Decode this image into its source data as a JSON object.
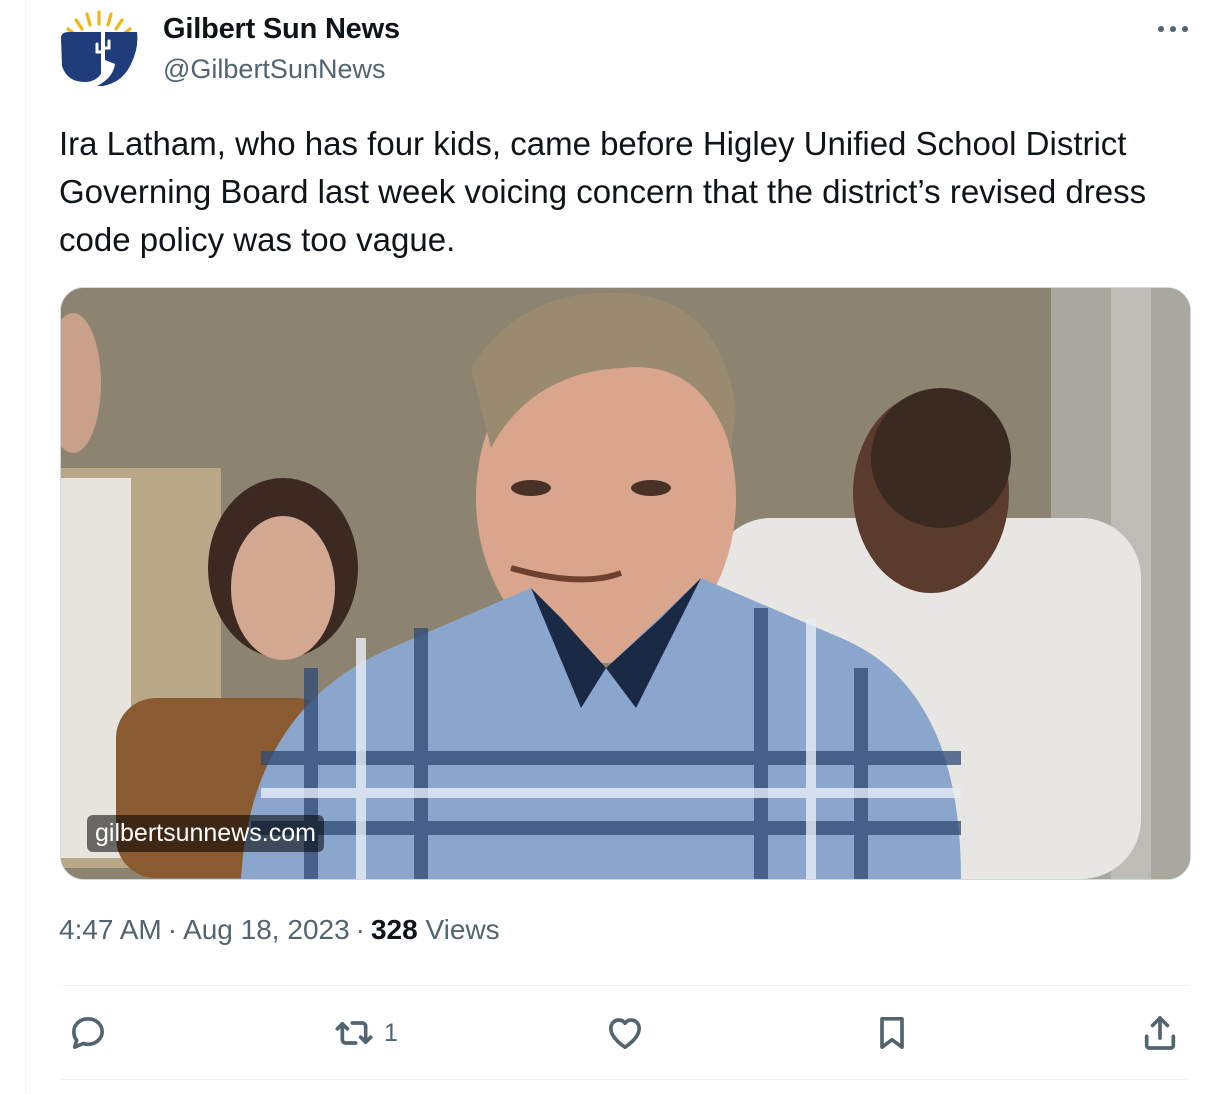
{
  "author": {
    "name": "Gilbert Sun News",
    "handle": "@GilbertSunNews",
    "avatar_icon": "gilbert-sun-logo"
  },
  "tweet": {
    "text": "Ira Latham, who has four kids, came before Higley Unified School District Governing Board last week voicing concern that the district’s revised dress code policy was too vague.",
    "media": {
      "watermark": "gilbertsunnews.com",
      "description_icon": "photo"
    },
    "time": "4:47 AM",
    "date": "Aug 18, 2023",
    "views_count": "328",
    "views_label": "Views",
    "separator": "·"
  },
  "actions": {
    "reply": {
      "icon": "reply-icon",
      "count": ""
    },
    "retweet": {
      "icon": "retweet-icon",
      "count": "1"
    },
    "like": {
      "icon": "heart-icon",
      "count": ""
    },
    "bookmark": {
      "icon": "bookmark-icon",
      "count": ""
    },
    "share": {
      "icon": "share-icon",
      "count": ""
    }
  },
  "colors": {
    "text_primary": "#0f1419",
    "text_secondary": "#536471",
    "border": "#cfd9de",
    "logo_blue": "#1f3d7a",
    "logo_sun": "#f2b516"
  }
}
